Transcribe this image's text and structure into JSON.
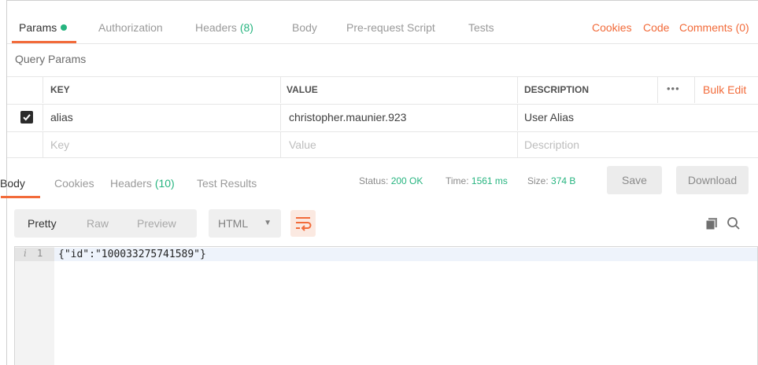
{
  "request_tabs": {
    "params": "Params",
    "authorization": "Authorization",
    "headers_label": "Headers",
    "headers_count": "(8)",
    "body": "Body",
    "pre_request": "Pre-request Script",
    "tests": "Tests"
  },
  "request_links": {
    "cookies": "Cookies",
    "code": "Code",
    "comments": "Comments (0)"
  },
  "query_params": {
    "title": "Query Params",
    "columns": {
      "key": "KEY",
      "value": "VALUE",
      "description": "DESCRIPTION"
    },
    "more_icon_text": "•••",
    "bulk_edit": "Bulk Edit",
    "rows": [
      {
        "checked": true,
        "key": "alias",
        "value": "christopher.maunier.923",
        "description": "User Alias"
      }
    ],
    "placeholder": {
      "key": "Key",
      "value": "Value",
      "description": "Description"
    }
  },
  "response_tabs": {
    "body": "Body",
    "cookies": "Cookies",
    "headers_label": "Headers",
    "headers_count": "(10)",
    "test_results": "Test Results"
  },
  "response_status": {
    "status_label": "Status:",
    "status_value": "200 OK",
    "time_label": "Time:",
    "time_value": "1561 ms",
    "size_label": "Size:",
    "size_value": "374 B"
  },
  "response_actions": {
    "save": "Save",
    "download": "Download"
  },
  "view_controls": {
    "pretty": "Pretty",
    "raw": "Raw",
    "preview": "Preview",
    "format": "HTML"
  },
  "editor": {
    "line_number": "1",
    "info_marker": "i",
    "code": "{\"id\":\"100033275741589\"}"
  },
  "colors": {
    "accent": "#f26b3a",
    "success": "#26b47f"
  },
  "icons": [
    "status-dot-icon",
    "checkbox-checked-icon",
    "more-options-icon",
    "caret-down-icon",
    "wrap-lines-icon",
    "copy-icon",
    "search-icon",
    "info-icon"
  ]
}
